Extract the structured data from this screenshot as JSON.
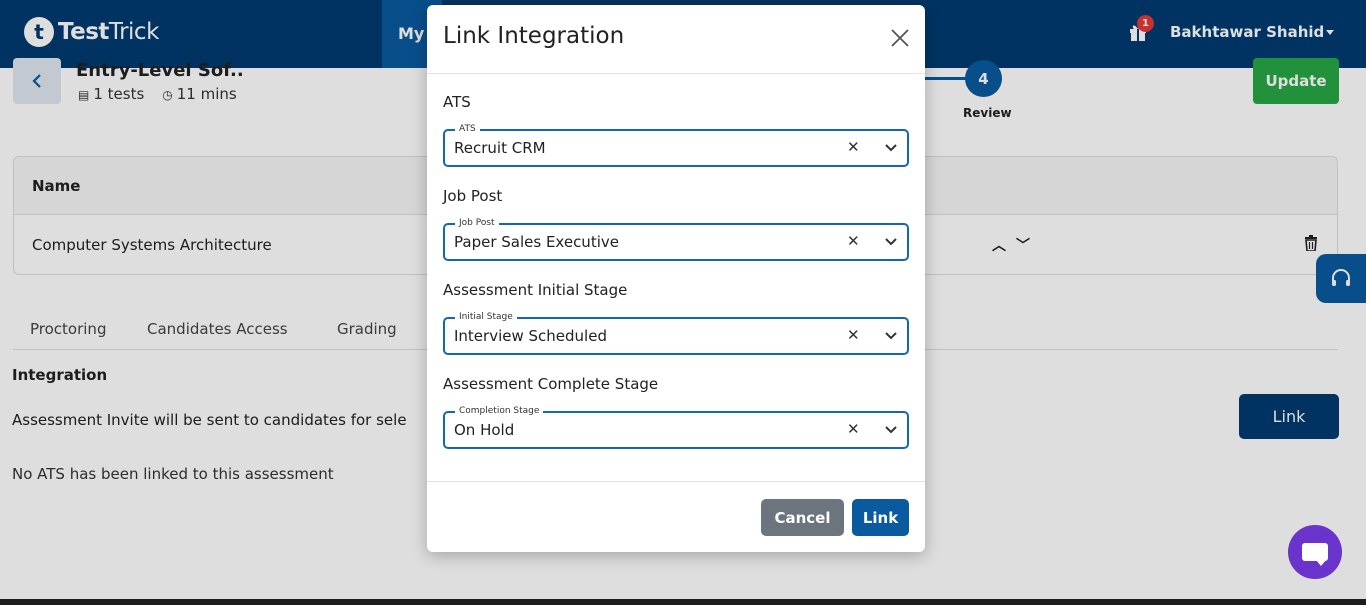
{
  "header": {
    "logo_letter": "t",
    "logo_bold": "Test",
    "logo_light": "Trick",
    "nav_tab": "My",
    "notification_count": "1",
    "user_name": "Bakhtawar Shahid"
  },
  "page": {
    "title": "Entry-Level Sof..",
    "tests": "1 tests",
    "duration": "11 mins",
    "step_number": "4",
    "step_label": "Review",
    "update_label": "Update"
  },
  "table": {
    "header_name": "Name",
    "rows": [
      {
        "name": "Computer Systems Architecture"
      }
    ]
  },
  "tabs": [
    "Proctoring",
    "Candidates Access",
    "Grading"
  ],
  "integration": {
    "title": "Integration",
    "description": "Assessment Invite will be sent to candidates for sele",
    "link_label": "Link",
    "empty": "No ATS has been linked to this assessment"
  },
  "modal": {
    "title": "Link Integration",
    "fields": [
      {
        "label": "ATS",
        "legend": "ATS",
        "value": "Recruit CRM"
      },
      {
        "label": "Job Post",
        "legend": "Job Post",
        "value": "Paper Sales Executive"
      },
      {
        "label": "Assessment Initial Stage",
        "legend": "Initial Stage",
        "value": "Interview Scheduled"
      },
      {
        "label": "Assessment Complete Stage",
        "legend": "Completion Stage",
        "value": "On Hold"
      }
    ],
    "cancel_label": "Cancel",
    "link_label": "Link"
  },
  "colors": {
    "brand": "#003b71",
    "accent": "#0a5aa0",
    "success": "#27a844",
    "chat": "#6a33cc"
  }
}
